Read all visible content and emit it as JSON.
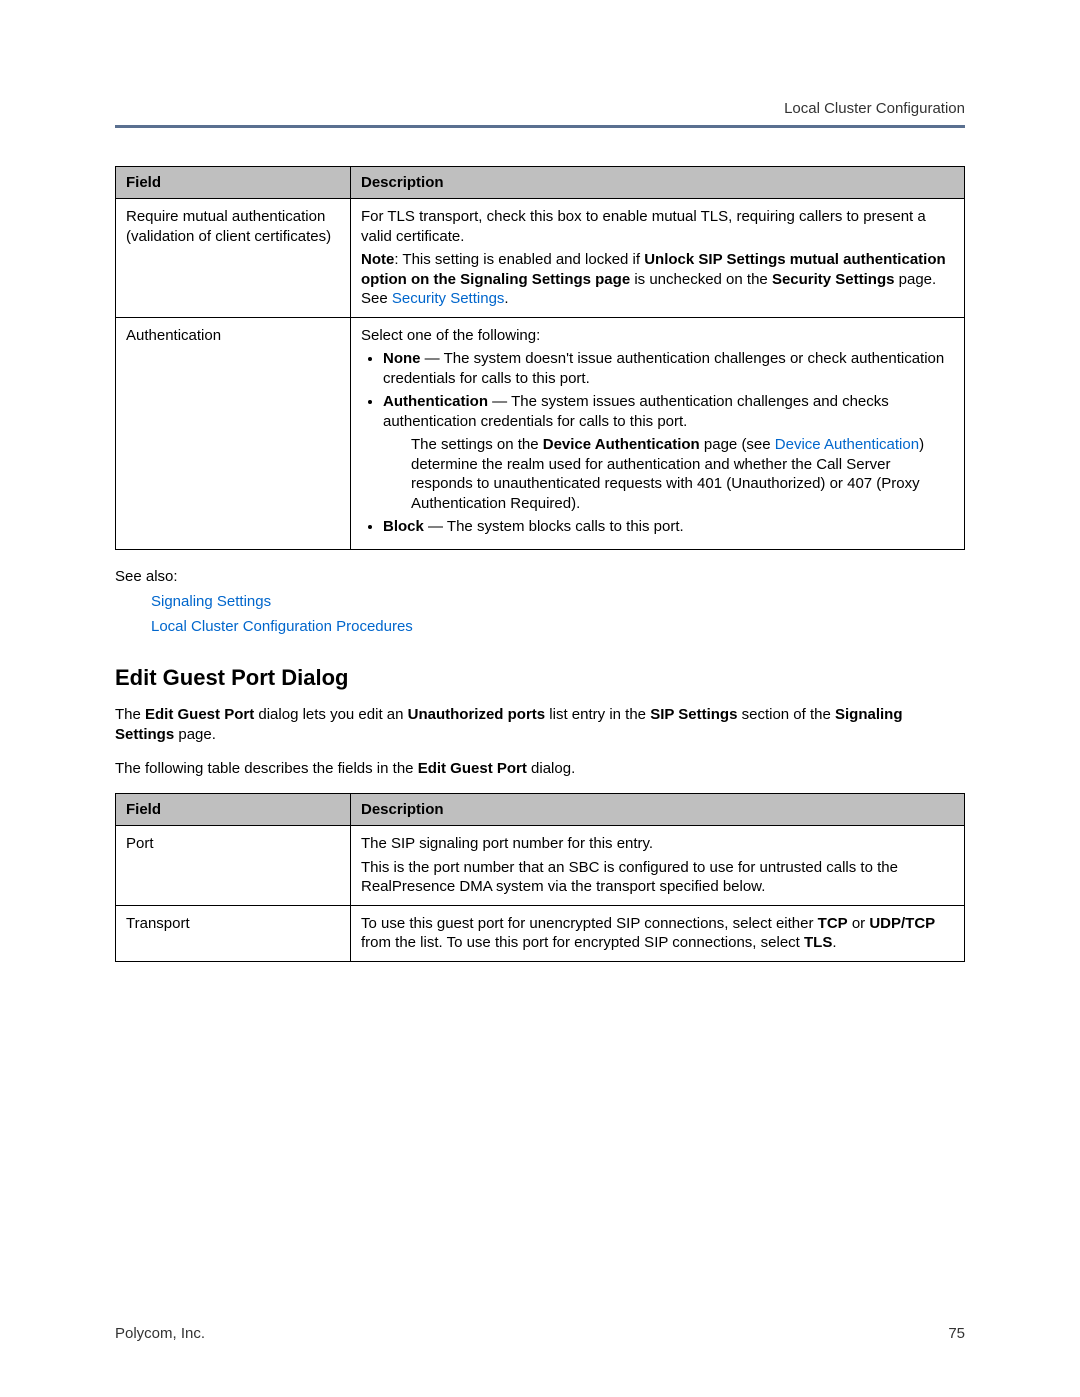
{
  "header": "Local Cluster Configuration",
  "table1": {
    "th_field": "Field",
    "th_desc": "Description",
    "row1_field": "Require mutual authentication (validation of client certificates)",
    "row1_p1a": "For TLS transport, check this box to enable mutual TLS, requiring callers to present a valid certificate.",
    "row1_note_label": "Note",
    "row1_note_a": ": This setting is enabled and locked if ",
    "row1_note_b": "Unlock SIP Settings mutual authentication option on the Signaling Settings page",
    "row1_note_c": " is unchecked on the ",
    "row1_note_d": "Security Settings",
    "row1_note_e": " page. See ",
    "row1_note_link": "Security Settings",
    "row1_note_f": ".",
    "row2_field": "Authentication",
    "row2_intro": "Select one of the following:",
    "row2_none_b": "None",
    "row2_none_t": " — The system doesn't issue authentication challenges or check authentication credentials for calls to this port.",
    "row2_auth_b": "Authentication",
    "row2_auth_t": " — The system issues authentication challenges and checks authentication credentials for calls to this port.",
    "row2_sub_a": "The settings on the ",
    "row2_sub_b": "Device Authentication",
    "row2_sub_c": " page (see ",
    "row2_sub_link": "Device Authentication",
    "row2_sub_d": ") determine the realm used for authentication and whether the Call Server responds to unauthenticated requests with 401 (Unauthorized) or 407 (Proxy Authentication Required).",
    "row2_block_b": "Block",
    "row2_block_t": " — The system blocks calls to this port."
  },
  "see_also": "See also:",
  "see_also_link1": "Signaling Settings",
  "see_also_link2": "Local Cluster Configuration Procedures",
  "section_title": "Edit Guest Port Dialog",
  "section_p1": {
    "a": "The ",
    "b": "Edit Guest Port",
    "c": " dialog lets you edit an ",
    "d": "Unauthorized ports",
    "e": " list entry in the ",
    "f": "SIP Settings",
    "g": " section of the ",
    "h": "Signaling Settings",
    "i": " page."
  },
  "section_p2": {
    "a": "The following table describes the fields in the ",
    "b": "Edit Guest Port",
    "c": " dialog."
  },
  "table2": {
    "th_field": "Field",
    "th_desc": "Description",
    "row1_field": "Port",
    "row1_p1": "The SIP signaling port number for this entry.",
    "row1_p2": "This is the port number that an SBC is configured to use for untrusted calls to the RealPresence DMA system via the transport specified below.",
    "row2_field": "Transport",
    "row2_a": "To use this guest port for unencrypted SIP connections, select either ",
    "row2_b": "TCP",
    "row2_c": " or ",
    "row2_d": "UDP/TCP",
    "row2_e": " from the list. To use this port for encrypted SIP connections, select ",
    "row2_f": "TLS",
    "row2_g": "."
  },
  "footer_company": "Polycom, Inc.",
  "footer_page": "75"
}
